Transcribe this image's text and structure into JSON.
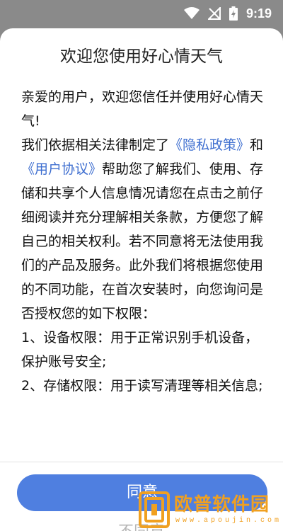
{
  "status_bar": {
    "time": "9:19",
    "icons": [
      "wifi-icon",
      "signal-off-icon",
      "battery-charging-icon"
    ]
  },
  "dialog": {
    "title": "欢迎您使用好心情天气",
    "body": {
      "p1": "亲爱的用户，欢迎您信任并使用好心情天气!",
      "p2_before": "我们依据相关法律制定了",
      "privacy_link": "《隐私政策》",
      "p2_and": "和",
      "terms_link": "《用户协议》",
      "p2_after": "帮助您了解我们、使用、存储和共享个人信息情况请您在点击之前仔细阅读并充分理解相关条款，方便您了解自己的相关权利。若不同意将无法使用我们的产品及服务。此外我们将根据您使用的不同功能，在首次安装时，向您询问是否授权您的如下权限：",
      "p3": "1、设备权限：用于正常识别手机设备，保护账号安全;",
      "p4": "2、存储权限：用于读写清理等相关信息;"
    },
    "agree_label": "同意",
    "disagree_label": "不同意"
  },
  "colors": {
    "accent": "#4f7fe0",
    "link": "#3f6fd0",
    "watermark": "#f0a020"
  },
  "watermark": {
    "text": "欧普软件园",
    "url": "www.apoujin.com"
  }
}
